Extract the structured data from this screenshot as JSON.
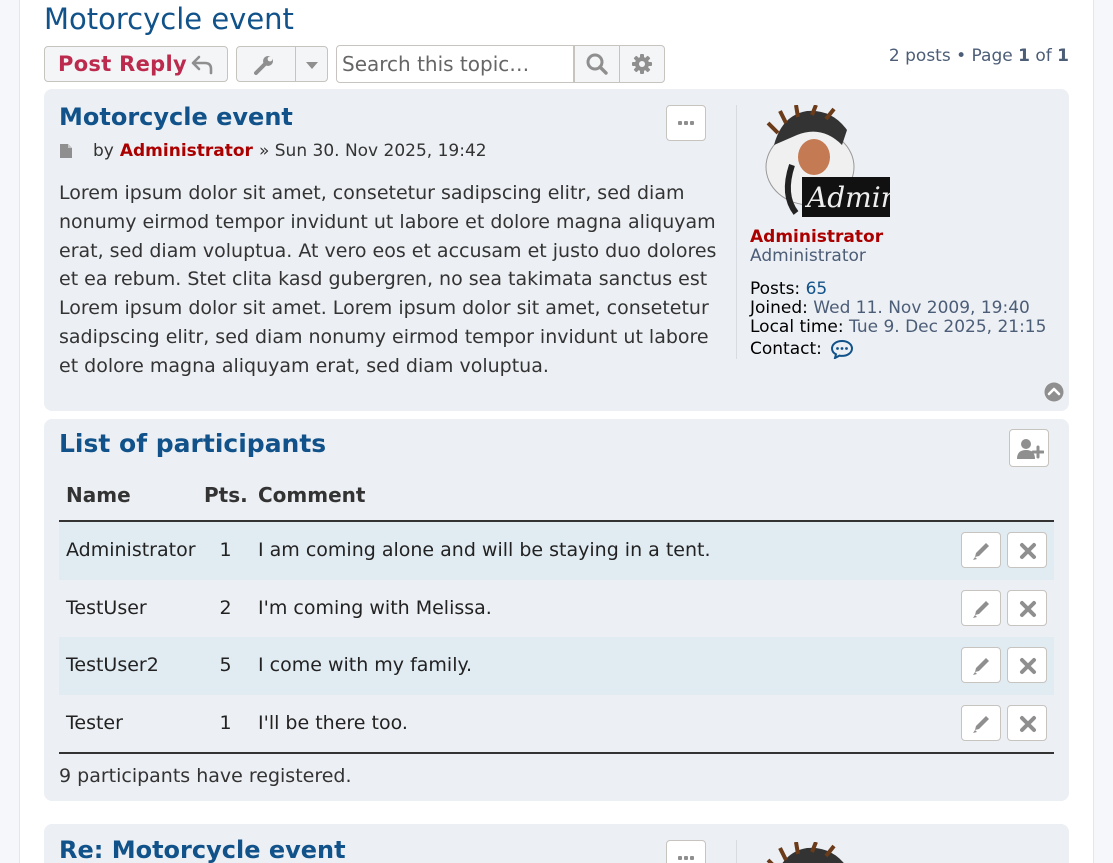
{
  "topic": {
    "title": "Motorcycle event"
  },
  "actions": {
    "post_reply": "Post Reply",
    "search_placeholder": "Search this topic…",
    "pagination": {
      "posts": "2 posts",
      "sep": "•",
      "page_label": "Page",
      "current": "1",
      "of": "of",
      "total": "1"
    }
  },
  "post1": {
    "title": "Motorcycle event",
    "by": "by",
    "author": "Administrator",
    "date": "» Sun 30. Nov 2025, 19:42",
    "content": "Lorem ipsum dolor sit amet, consetetur sadipscing elitr, sed diam nonumy eirmod tempor invidunt ut labore et dolore magna aliquyam erat, sed diam voluptua. At vero eos et accusam et justo duo dolores et ea rebum. Stet clita kasd gubergren, no sea takimata sanctus est Lorem ipsum dolor sit amet. Lorem ipsum dolor sit amet, consetetur sadipscing elitr, sed diam nonumy eirmod tempor invidunt ut labore et dolore magna aliquyam erat, sed diam voluptua.",
    "profile": {
      "avatar_text": "Admin",
      "name": "Administrator",
      "rank": "Administrator",
      "posts_label": "Posts:",
      "posts_value": "65",
      "joined_label": "Joined:",
      "joined_value": "Wed 11. Nov 2009, 19:40",
      "localtime_label": "Local time:",
      "localtime_value": "Tue 9. Dec 2025, 21:15",
      "contact_label": "Contact:"
    }
  },
  "participants": {
    "title": "List of participants",
    "headers": {
      "name": "Name",
      "pts": "Pts.",
      "comment": "Comment"
    },
    "rows": [
      {
        "name": "Administrator",
        "pts": "1",
        "comment": "I am coming alone and will be staying in a tent."
      },
      {
        "name": "TestUser",
        "pts": "2",
        "comment": "I'm coming with Melissa."
      },
      {
        "name": "TestUser2",
        "pts": "5",
        "comment": "I come with my family."
      },
      {
        "name": "Tester",
        "pts": "1",
        "comment": "I'll be there too."
      }
    ],
    "footer": "9 participants have registered."
  },
  "post2": {
    "title": "Re: Motorcycle event"
  },
  "colors": {
    "link": "#105289",
    "author": "#aa0000",
    "reply": "#bc2a4d",
    "panel": "#eceff3",
    "row_alt": "#e1ebf2"
  }
}
